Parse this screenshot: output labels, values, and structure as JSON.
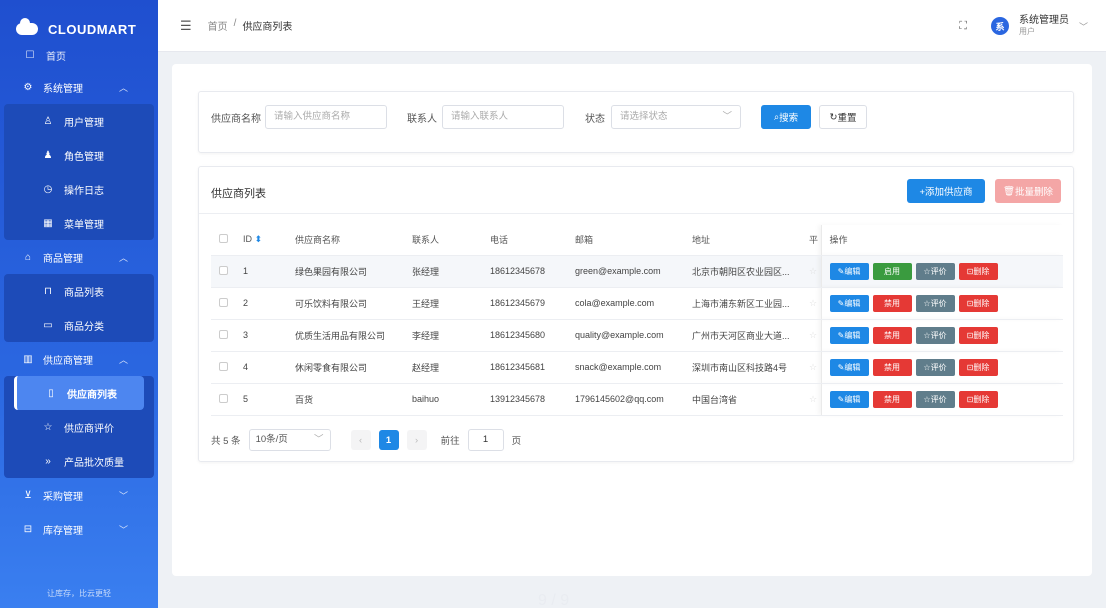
{
  "brand": "CLOUDMART",
  "sidebar": {
    "top_item": "首页",
    "groups": [
      {
        "label": "系统管理",
        "items": [
          "用户管理",
          "角色管理",
          "操作日志",
          "菜单管理"
        ]
      },
      {
        "label": "商品管理",
        "items": [
          "商品列表",
          "商品分类"
        ]
      },
      {
        "label": "供应商管理",
        "items": [
          "供应商列表",
          "供应商评价",
          "产品批次质量"
        ]
      },
      {
        "label": "采购管理"
      },
      {
        "label": "库存管理"
      }
    ],
    "footer": "让库存，比云更轻"
  },
  "header": {
    "breadcrumb": [
      "首页",
      "/",
      "供应商列表"
    ],
    "user_name": "系统管理员",
    "user_role": "用户",
    "avatar_text": "系"
  },
  "search": {
    "name_label": "供应商名称",
    "name_placeholder": "请输入供应商名称",
    "contact_label": "联系人",
    "contact_placeholder": "请输入联系人",
    "status_label": "状态",
    "status_placeholder": "请选择状态",
    "search_btn": "搜索",
    "reset_btn": "重置"
  },
  "list": {
    "title": "供应商列表",
    "add_btn": "+添加供应商",
    "batch_delete_btn": "批量删除",
    "columns": [
      "ID",
      "供应商名称",
      "联系人",
      "电话",
      "邮箱",
      "地址",
      "平",
      "操作"
    ],
    "rows": [
      {
        "id": "1",
        "name": "绿色果园有限公司",
        "contact": "张经理",
        "phone": "18612345678",
        "email": "green@example.com",
        "address": "北京市朝阳区农业园区...",
        "toggle": "启用"
      },
      {
        "id": "2",
        "name": "可乐饮料有限公司",
        "contact": "王经理",
        "phone": "18612345679",
        "email": "cola@example.com",
        "address": "上海市浦东新区工业园...",
        "toggle": "禁用"
      },
      {
        "id": "3",
        "name": "优质生活用品有限公司",
        "contact": "李经理",
        "phone": "18612345680",
        "email": "quality@example.com",
        "address": "广州市天河区商业大道...",
        "toggle": "禁用"
      },
      {
        "id": "4",
        "name": "休闲零食有限公司",
        "contact": "赵经理",
        "phone": "18612345681",
        "email": "snack@example.com",
        "address": "深圳市南山区科技路4号",
        "toggle": "禁用"
      },
      {
        "id": "5",
        "name": "百货",
        "contact": "baihuo",
        "phone": "13912345678",
        "email": "1796145602@qq.com",
        "address": "中国台湾省",
        "toggle": "禁用"
      }
    ],
    "op_edit": "编辑",
    "op_rate": "评价",
    "op_delete": "删除"
  },
  "pager": {
    "total": "共 5 条",
    "page_size": "10条/页",
    "current": "1",
    "goto_label": "前往",
    "goto_value": "1",
    "page_unit": "页"
  },
  "watermark": "9 / 9"
}
